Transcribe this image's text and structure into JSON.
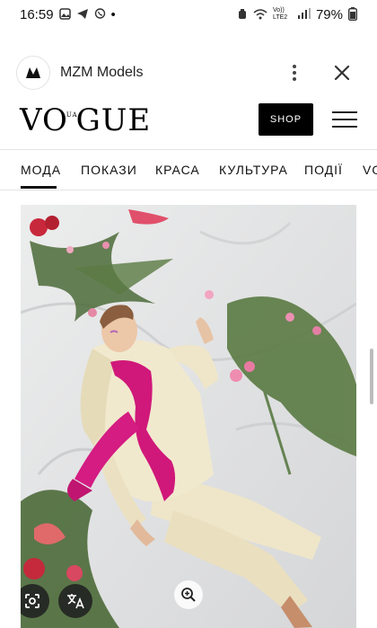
{
  "status_bar": {
    "time": "16:59",
    "dot": "•",
    "network_label": "Vo)) LTE2",
    "battery_percent": "79%"
  },
  "app_header": {
    "title": "MZM Models",
    "logo_icon": "mzm-logo-icon",
    "more_icon": "more-vert-icon",
    "close_icon": "close-icon"
  },
  "vogue": {
    "logo_left": "VO",
    "logo_ua": "UA",
    "logo_right": "GUE",
    "shop_label": "SHOP"
  },
  "nav": {
    "items": [
      "МОДА",
      "ПОКАЗИ",
      "КРАСА",
      "КУЛЬТУРА",
      "ПОДІЇ",
      "VO"
    ],
    "active_index": 0
  },
  "image_controls": {
    "lens_icon": "google-lens-icon",
    "translate_icon": "translate-icon",
    "zoom_icon": "zoom-in-icon"
  },
  "colors": {
    "accent_black": "#000000",
    "scarf_pink": "#d0187a",
    "suit_cream": "#efe6c9",
    "sheet_white": "#e6e6e6"
  }
}
